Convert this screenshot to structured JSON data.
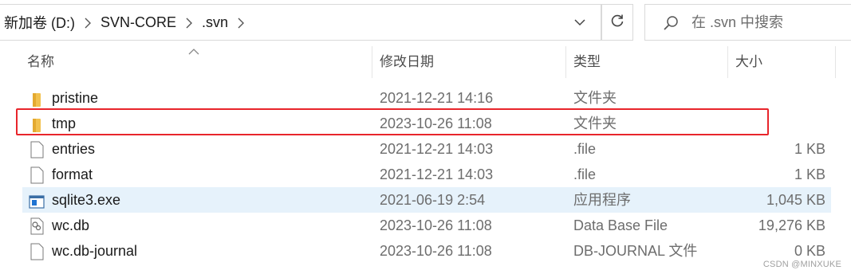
{
  "address_bar": {
    "breadcrumbs": [
      "新加卷 (D:)",
      "SVN-CORE",
      ".svn"
    ]
  },
  "search": {
    "placeholder": "在 .svn 中搜索"
  },
  "columns": {
    "name": "名称",
    "modified": "修改日期",
    "type": "类型",
    "size": "大小"
  },
  "files": [
    {
      "name": "pristine",
      "modified": "2021-12-21 14:16",
      "type": "文件夹",
      "size": "",
      "icon": "folder-icon"
    },
    {
      "name": "tmp",
      "modified": "2023-10-26 11:08",
      "type": "文件夹",
      "size": "",
      "icon": "folder-icon"
    },
    {
      "name": "entries",
      "modified": "2021-12-21 14:03",
      "type": ".file",
      "size": "1 KB",
      "icon": "file-icon"
    },
    {
      "name": "format",
      "modified": "2021-12-21 14:03",
      "type": ".file",
      "size": "1 KB",
      "icon": "file-icon"
    },
    {
      "name": "sqlite3.exe",
      "modified": "2021-06-19 2:54",
      "type": "应用程序",
      "size": "1,045 KB",
      "icon": "exe-icon"
    },
    {
      "name": "wc.db",
      "modified": "2023-10-26 11:08",
      "type": "Data Base File",
      "size": "19,276 KB",
      "icon": "db-file-icon"
    },
    {
      "name": "wc.db-journal",
      "modified": "2023-10-26 11:08",
      "type": "DB-JOURNAL 文件",
      "size": "0 KB",
      "icon": "file-icon"
    }
  ],
  "watermark": "CSDN @MINXUKE",
  "colors": {
    "highlight": "#e8252b",
    "selection": "#e6f2fb",
    "folder": "#f2c14e"
  }
}
